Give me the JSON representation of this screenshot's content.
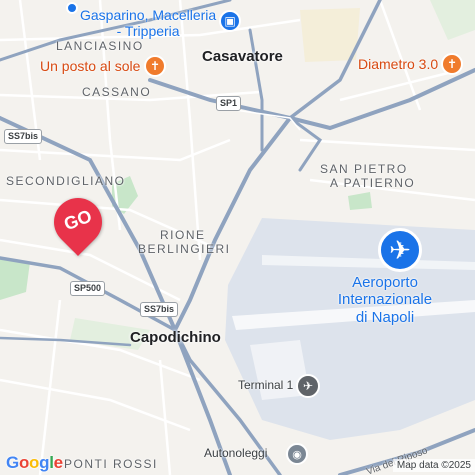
{
  "map": {
    "area_labels": [
      "LANCIASINO",
      "CASSANO",
      "SECONDIGLIANO",
      "RIONE",
      "BERLINGIERI",
      "SAN PIETRO",
      "A PATIERNO",
      "PONTI ROSSI"
    ],
    "towns": [
      "Casavatore",
      "Capodichino"
    ],
    "pois": {
      "shop": [
        "Gasparino, Macelleria",
        "- Tripperia"
      ],
      "restaurants": [
        "Un posto al sole",
        "Diametro 3.0"
      ],
      "airport": [
        "Aeroporto",
        "Internazionale",
        "di Napoli"
      ],
      "terminal": "Terminal 1",
      "parking": "Autonoleggi"
    },
    "roads": {
      "shields": [
        "SP1",
        "SS7bis",
        "SS7bis",
        "SP500"
      ],
      "street": "Via del Riposo"
    },
    "marker": {
      "label": "GO",
      "color": "#e8334a"
    },
    "icons": [
      "shopping-bag-icon",
      "fork-knife-icon",
      "fork-knife-icon",
      "airplane-icon",
      "plane-terminal-icon",
      "car-rental-icon"
    ],
    "colors": {
      "roads": "#8fa3bf",
      "minor_roads": "#ffffff",
      "airport": "#dde3ec",
      "parks": "#c8e6c9",
      "poi_food": "#f07b2c",
      "poi_blue": "#1a73e8"
    }
  },
  "attribution": {
    "logo": "Google",
    "text": "Map data ©2025"
  }
}
